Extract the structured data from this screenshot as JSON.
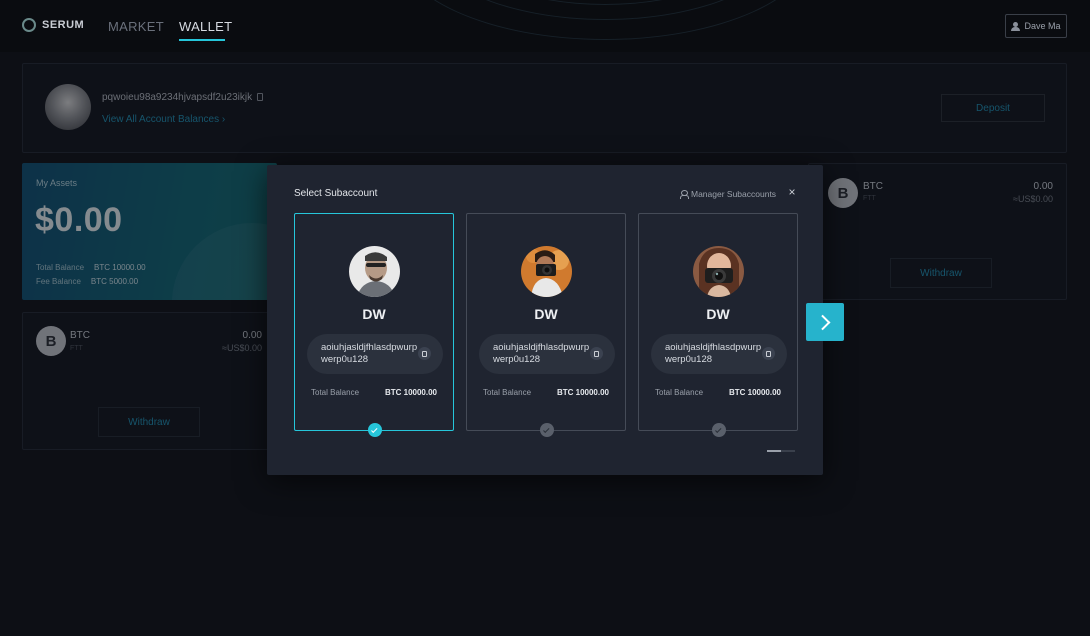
{
  "nav": {
    "logo_text": "SERUM",
    "items": [
      {
        "label": "MARKET"
      },
      {
        "label": "WALLET"
      }
    ],
    "user_label": "Dave Ma"
  },
  "account": {
    "address": "pqwoieu98a9234hjvapsdf2u23ikjk",
    "view_all_link": "View All Account Balances ›",
    "deposit_label": "Deposit"
  },
  "assets": {
    "title": "My Assets",
    "amount": "$0.00",
    "total_balance_label": "Total Balance",
    "total_balance_value": "BTC 10000.00",
    "fee_balance_label": "Fee Balance",
    "fee_balance_value": "BTC 5000.00"
  },
  "coin_cards": [
    {
      "symbol": "B",
      "name": "BTC",
      "sub": "FTT",
      "amount": "0.00",
      "usd": "≈US$0.00",
      "withdraw_label": "Withdraw"
    },
    {
      "symbol": "B",
      "name": "BTC",
      "sub": "FTT",
      "amount": "0.00",
      "usd": "≈US$0.00",
      "withdraw_label": "Withdraw"
    }
  ],
  "modal": {
    "title": "Select Subaccount",
    "manage_label": "Manager Subaccounts",
    "close_glyph": "×",
    "subaccounts": [
      {
        "name": "DW",
        "address": "aoiuhjasldjfhlasdpwurpwerp0u128",
        "balance_label": "Total Balance",
        "balance_value": "BTC 10000.00",
        "selected": true
      },
      {
        "name": "DW",
        "address": "aoiuhjasldjfhlasdpwurpwerp0u128",
        "balance_label": "Total Balance",
        "balance_value": "BTC 10000.00",
        "selected": false
      },
      {
        "name": "DW",
        "address": "aoiuhjasldjfhlasdpwurpwerp0u128",
        "balance_label": "Total Balance",
        "balance_value": "BTC 10000.00",
        "selected": false
      }
    ],
    "page_progress": 0.5
  },
  "icons": {
    "copy": "copy-icon",
    "user": "user-icon",
    "check": "check-icon",
    "next": "chevron-right-icon",
    "close": "close-icon"
  },
  "colors": {
    "accent": "#26c6da",
    "link": "#1f8fb3",
    "background": "#0d0f15",
    "modal": "#1f2430"
  }
}
